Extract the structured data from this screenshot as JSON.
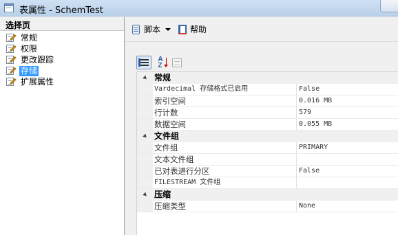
{
  "window": {
    "title": "表属性 - SchemTest"
  },
  "left_panel": {
    "header": "选择页",
    "items": [
      {
        "label": "常规",
        "selected": false
      },
      {
        "label": "权限",
        "selected": false
      },
      {
        "label": "更改跟踪",
        "selected": false
      },
      {
        "label": "存储",
        "selected": true
      },
      {
        "label": "扩展属性",
        "selected": false
      }
    ]
  },
  "toolbar": {
    "script_label": "脚本",
    "help_label": "帮助"
  },
  "property_grid": {
    "categories": [
      {
        "name": "常规",
        "properties": [
          {
            "name": "Vardecimal 存储格式已启用",
            "value": "False"
          },
          {
            "name": "索引空间",
            "value": "0.016 MB"
          },
          {
            "name": "行计数",
            "value": "579"
          },
          {
            "name": "数据空间",
            "value": "0.055 MB"
          }
        ]
      },
      {
        "name": "文件组",
        "properties": [
          {
            "name": "文件组",
            "value": "PRIMARY"
          },
          {
            "name": "文本文件组",
            "value": ""
          },
          {
            "name": "已对表进行分区",
            "value": "False"
          },
          {
            "name": "FILESTREAM 文件组",
            "value": ""
          }
        ]
      },
      {
        "name": "压缩",
        "properties": [
          {
            "name": "压缩类型",
            "value": "None"
          }
        ]
      }
    ]
  }
}
